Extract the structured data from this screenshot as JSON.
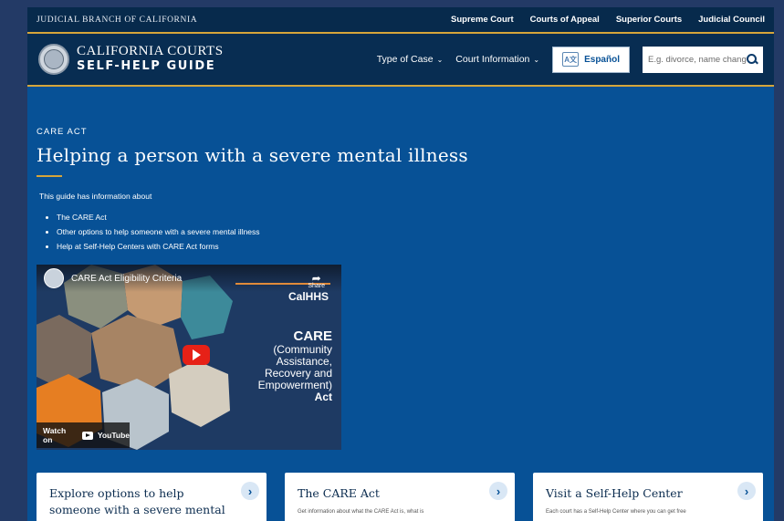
{
  "utility": {
    "brand": "JUDICIAL BRANCH OF CALIFORNIA",
    "links": [
      "Supreme Court",
      "Courts of Appeal",
      "Superior Courts",
      "Judicial Council"
    ]
  },
  "header": {
    "logo_line1": "CALIFORNIA COURTS",
    "logo_line2": "SELF-HELP GUIDE",
    "nav": [
      "Type of Case",
      "Court Information"
    ],
    "espanol": "Español",
    "search_placeholder": "E.g. divorce, name change"
  },
  "main": {
    "eyebrow": "CARE ACT",
    "title": "Helping a person with a severe mental illness",
    "intro": "This guide has information about",
    "bullets": [
      "The CARE Act",
      "Other options to help someone with a severe mental illness",
      "Help at Self-Help Centers with CARE Act forms"
    ]
  },
  "video": {
    "title": "CARE Act Eligibility Criteria",
    "share_label": "Share",
    "hhs": "CalHHS",
    "care_big": "CARE",
    "care_sub": [
      "(Community",
      "Assistance,",
      "Recovery and",
      "Empowerment)"
    ],
    "care_act": "Act",
    "watch_on": "Watch on",
    "youtube": "YouTube"
  },
  "cards": [
    {
      "title": "Explore options to help someone with a severe mental illness",
      "desc": ""
    },
    {
      "title": "The CARE Act",
      "desc": "Get information about what the CARE Act is, what is"
    },
    {
      "title": "Visit a Self-Help Center",
      "desc": "Each court has a Self-Help Center where you can get free"
    }
  ],
  "colors": {
    "page_bg": "#075196",
    "header_bg": "#082d52",
    "accent_gold": "#d6a53a",
    "youtube_red": "#e62117"
  }
}
